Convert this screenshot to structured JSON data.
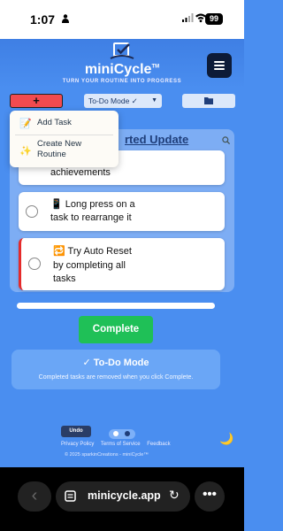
{
  "status_bar": {
    "time": "1:07",
    "battery": "99"
  },
  "header": {
    "title": "miniCycle",
    "trademark": "TM",
    "tagline": "TURN YOUR ROUTINE INTO PROGRESS"
  },
  "toolbar": {
    "add_label": "+",
    "mode": "To-Do Mode ✓",
    "mode_caret": "▼"
  },
  "dropdown": {
    "items": [
      {
        "icon": "📝",
        "label": "Add Task"
      },
      {
        "icon": "✨",
        "label": "Create New Routine"
      }
    ]
  },
  "panel": {
    "title": "rted Update"
  },
  "tasks": [
    {
      "lines": [
        "achievements"
      ]
    },
    {
      "lines": [
        "📱 Long press on a",
        "task to rearrange it"
      ]
    },
    {
      "lines": [
        "🔁 Try Auto Reset",
        "by completing all",
        "tasks"
      ]
    }
  ],
  "complete_label": "Complete",
  "info": {
    "title": "✓ To-Do Mode",
    "description": "Completed tasks are removed when you click Complete."
  },
  "footer": {
    "undo": "Undo",
    "links": [
      "Privacy Policy",
      "Terms of Service",
      "Feedback"
    ],
    "copyright": "© 2025 sparkinCreations - miniCycle™",
    "moon": "🌙"
  },
  "browser": {
    "url": "minicycle.app",
    "back": "‹",
    "reload": "↻",
    "more": "•••"
  },
  "colors": {
    "accent_red": "#f24b4f",
    "complete_green": "#1fc057",
    "header_dark": "#0d1b38",
    "page_blue": "#4a8ef0"
  }
}
